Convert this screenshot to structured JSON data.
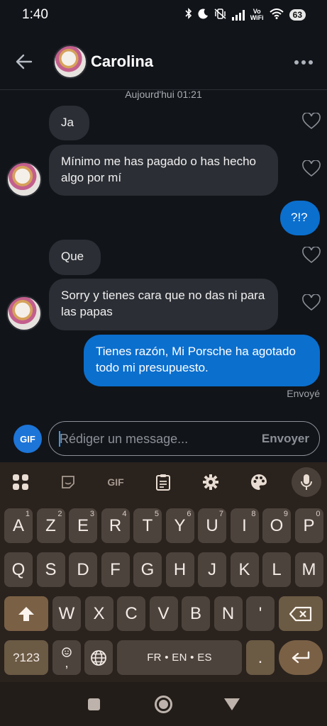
{
  "status": {
    "time": "1:40",
    "vo_wifi_top": "Vo",
    "vo_wifi_bottom": "WiFi",
    "battery": "63"
  },
  "header": {
    "contact_name": "Carolina"
  },
  "chat": {
    "date_label": "Aujourd'hui 01:21",
    "messages": [
      {
        "dir": "in",
        "text": "Ja"
      },
      {
        "dir": "in",
        "text": "Mínimo me has pagado o has hecho algo por mí"
      },
      {
        "dir": "out",
        "text": "?!?"
      },
      {
        "dir": "in",
        "text": "Que"
      },
      {
        "dir": "in",
        "text": "Sorry y tienes cara que no das ni para las papas"
      },
      {
        "dir": "out",
        "text": "Tienes razón, Mi Porsche ha agotado todo mi presupuesto."
      }
    ],
    "sent_status": "Envoyé"
  },
  "composer": {
    "gif_label": "GIF",
    "placeholder": "Rédiger un message...",
    "send_label": "Envoyer"
  },
  "keyboard": {
    "toolbar_gif": "GIF",
    "row1": [
      {
        "k": "A",
        "n": "1"
      },
      {
        "k": "Z",
        "n": "2"
      },
      {
        "k": "E",
        "n": "3"
      },
      {
        "k": "R",
        "n": "4"
      },
      {
        "k": "T",
        "n": "5"
      },
      {
        "k": "Y",
        "n": "6"
      },
      {
        "k": "U",
        "n": "7"
      },
      {
        "k": "I",
        "n": "8"
      },
      {
        "k": "O",
        "n": "9"
      },
      {
        "k": "P",
        "n": "0"
      }
    ],
    "row2": [
      "Q",
      "S",
      "D",
      "F",
      "G",
      "H",
      "J",
      "K",
      "L",
      "M"
    ],
    "row3": [
      "W",
      "X",
      "C",
      "V",
      "B",
      "N",
      "'"
    ],
    "symbols_key": "?123",
    "emoji_key_bottom": ",",
    "space_label": "FR • EN • ES",
    "period_key": "."
  },
  "colors": {
    "outgoing": "#0b6fce",
    "incoming": "#2b2e34",
    "accent": "#2e9bff"
  }
}
